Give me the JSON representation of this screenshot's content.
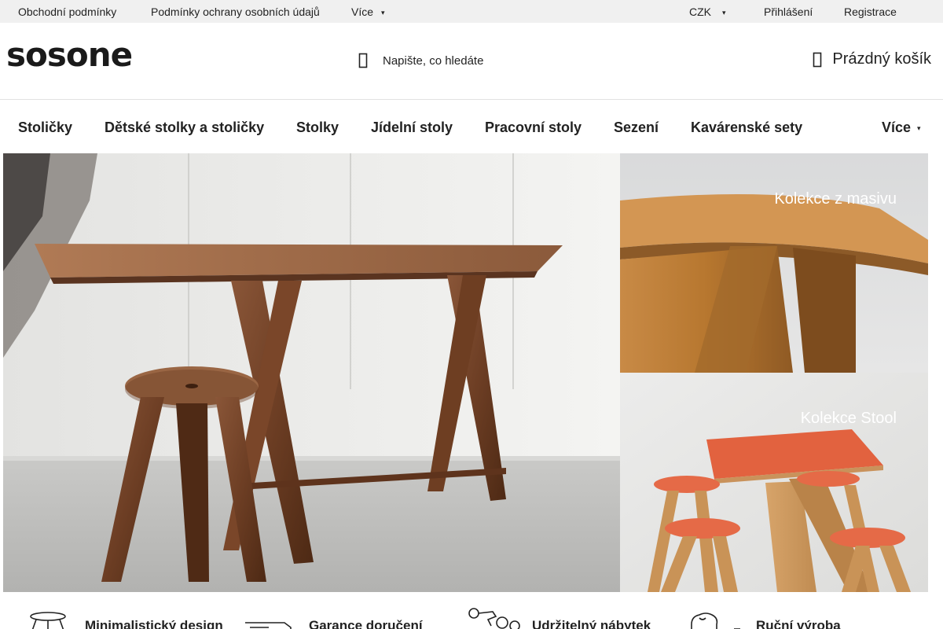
{
  "topbar": {
    "links": [
      "Obchodní podmínky",
      "Podmínky ochrany osobních údajů"
    ],
    "more_label": "Více",
    "currency": "CZK",
    "login": "Přihlášení",
    "register": "Registrace"
  },
  "header": {
    "logo_text": "sosone",
    "search_placeholder": "Napište, co hledáte",
    "cart_label": "Prázdný košík"
  },
  "nav": {
    "items": [
      "Stoličky",
      "Dětské stolky a stoličky",
      "Stolky",
      "Jídelní stoly",
      "Pracovní stoly",
      "Sezení",
      "Kavárenské sety"
    ],
    "more_label": "Více"
  },
  "banners": {
    "side_top_caption": "Kolekce z masivu",
    "side_bottom_caption": "Kolekce Stool"
  },
  "features": [
    "Minimalistický design",
    "Garance doručení",
    "Udržitelný nábytek",
    "Ruční výroba"
  ],
  "icons": {
    "search": "magnifier-icon",
    "cart": "cart-icon",
    "caret": "chevron-down-icon"
  }
}
